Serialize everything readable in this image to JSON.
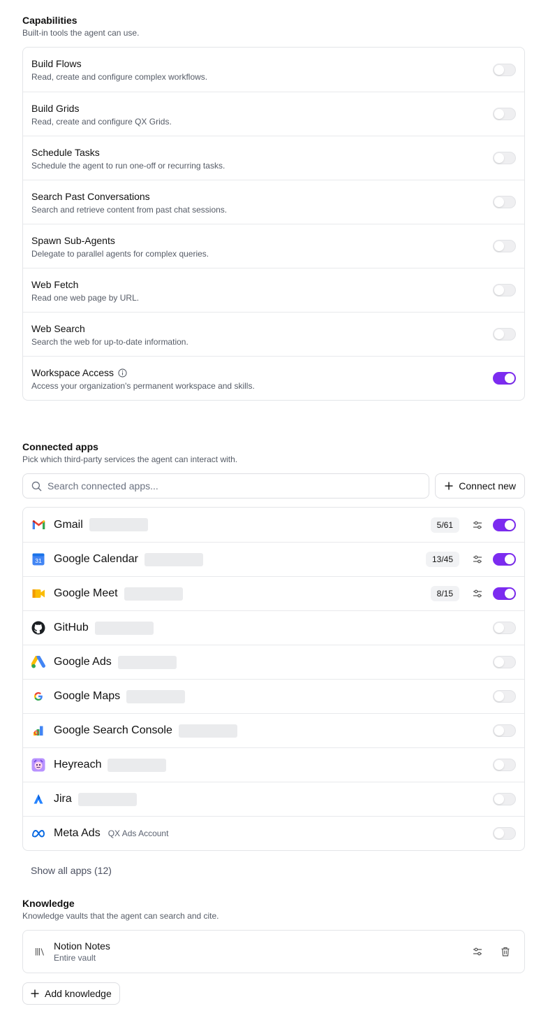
{
  "capabilities": {
    "title": "Capabilities",
    "description": "Built-in tools the agent can use.",
    "items": [
      {
        "name": "Build Flows",
        "description": "Read, create and configure complex workflows.",
        "enabled": false
      },
      {
        "name": "Build Grids",
        "description": "Read, create and configure QX Grids.",
        "enabled": false
      },
      {
        "name": "Schedule Tasks",
        "description": "Schedule the agent to run one-off or recurring tasks.",
        "enabled": false
      },
      {
        "name": "Search Past Conversations",
        "description": "Search and retrieve content from past chat sessions.",
        "enabled": false
      },
      {
        "name": "Spawn Sub-Agents",
        "description": "Delegate to parallel agents for complex queries.",
        "enabled": false
      },
      {
        "name": "Web Fetch",
        "description": "Read one web page by URL.",
        "enabled": false
      },
      {
        "name": "Web Search",
        "description": "Search the web for up-to-date information.",
        "enabled": false
      },
      {
        "name": "Workspace Access",
        "description": "Access your organization's permanent workspace and skills.",
        "enabled": true,
        "info_icon": "info-icon"
      }
    ]
  },
  "connected_apps": {
    "title": "Connected apps",
    "description": "Pick which third-party services the agent can interact with.",
    "search_placeholder": "Search connected apps...",
    "connect_new_label": "Connect new",
    "show_all_label": "Show all apps (12)",
    "apps": [
      {
        "name": "Gmail",
        "icon": "gmail-icon",
        "count": "5/61",
        "enabled": true,
        "account": ""
      },
      {
        "name": "Google Calendar",
        "icon": "google-calendar-icon",
        "count": "13/45",
        "enabled": true,
        "account": ""
      },
      {
        "name": "Google Meet",
        "icon": "google-meet-icon",
        "count": "8/15",
        "enabled": true,
        "account": ""
      },
      {
        "name": "GitHub",
        "icon": "github-icon",
        "count": "",
        "enabled": false,
        "account": ""
      },
      {
        "name": "Google Ads",
        "icon": "google-ads-icon",
        "count": "",
        "enabled": false,
        "account": ""
      },
      {
        "name": "Google Maps",
        "icon": "google-maps-icon",
        "count": "",
        "enabled": false,
        "account": ""
      },
      {
        "name": "Google Search Console",
        "icon": "google-search-console-icon",
        "count": "",
        "enabled": false,
        "account": ""
      },
      {
        "name": "Heyreach",
        "icon": "heyreach-icon",
        "count": "",
        "enabled": false,
        "account": ""
      },
      {
        "name": "Jira",
        "icon": "jira-icon",
        "count": "",
        "enabled": false,
        "account": ""
      },
      {
        "name": "Meta Ads",
        "icon": "meta-ads-icon",
        "count": "",
        "enabled": false,
        "account": "QX Ads Account"
      }
    ]
  },
  "knowledge": {
    "title": "Knowledge",
    "description": "Knowledge vaults that the agent can search and cite.",
    "items": [
      {
        "name": "Notion Notes",
        "scope": "Entire vault",
        "icon": "library-icon"
      }
    ],
    "add_label": "Add knowledge"
  },
  "colors": {
    "accent": "#7c2cf0",
    "toggle_off": "#efeff1",
    "border": "#e3e5e8"
  }
}
